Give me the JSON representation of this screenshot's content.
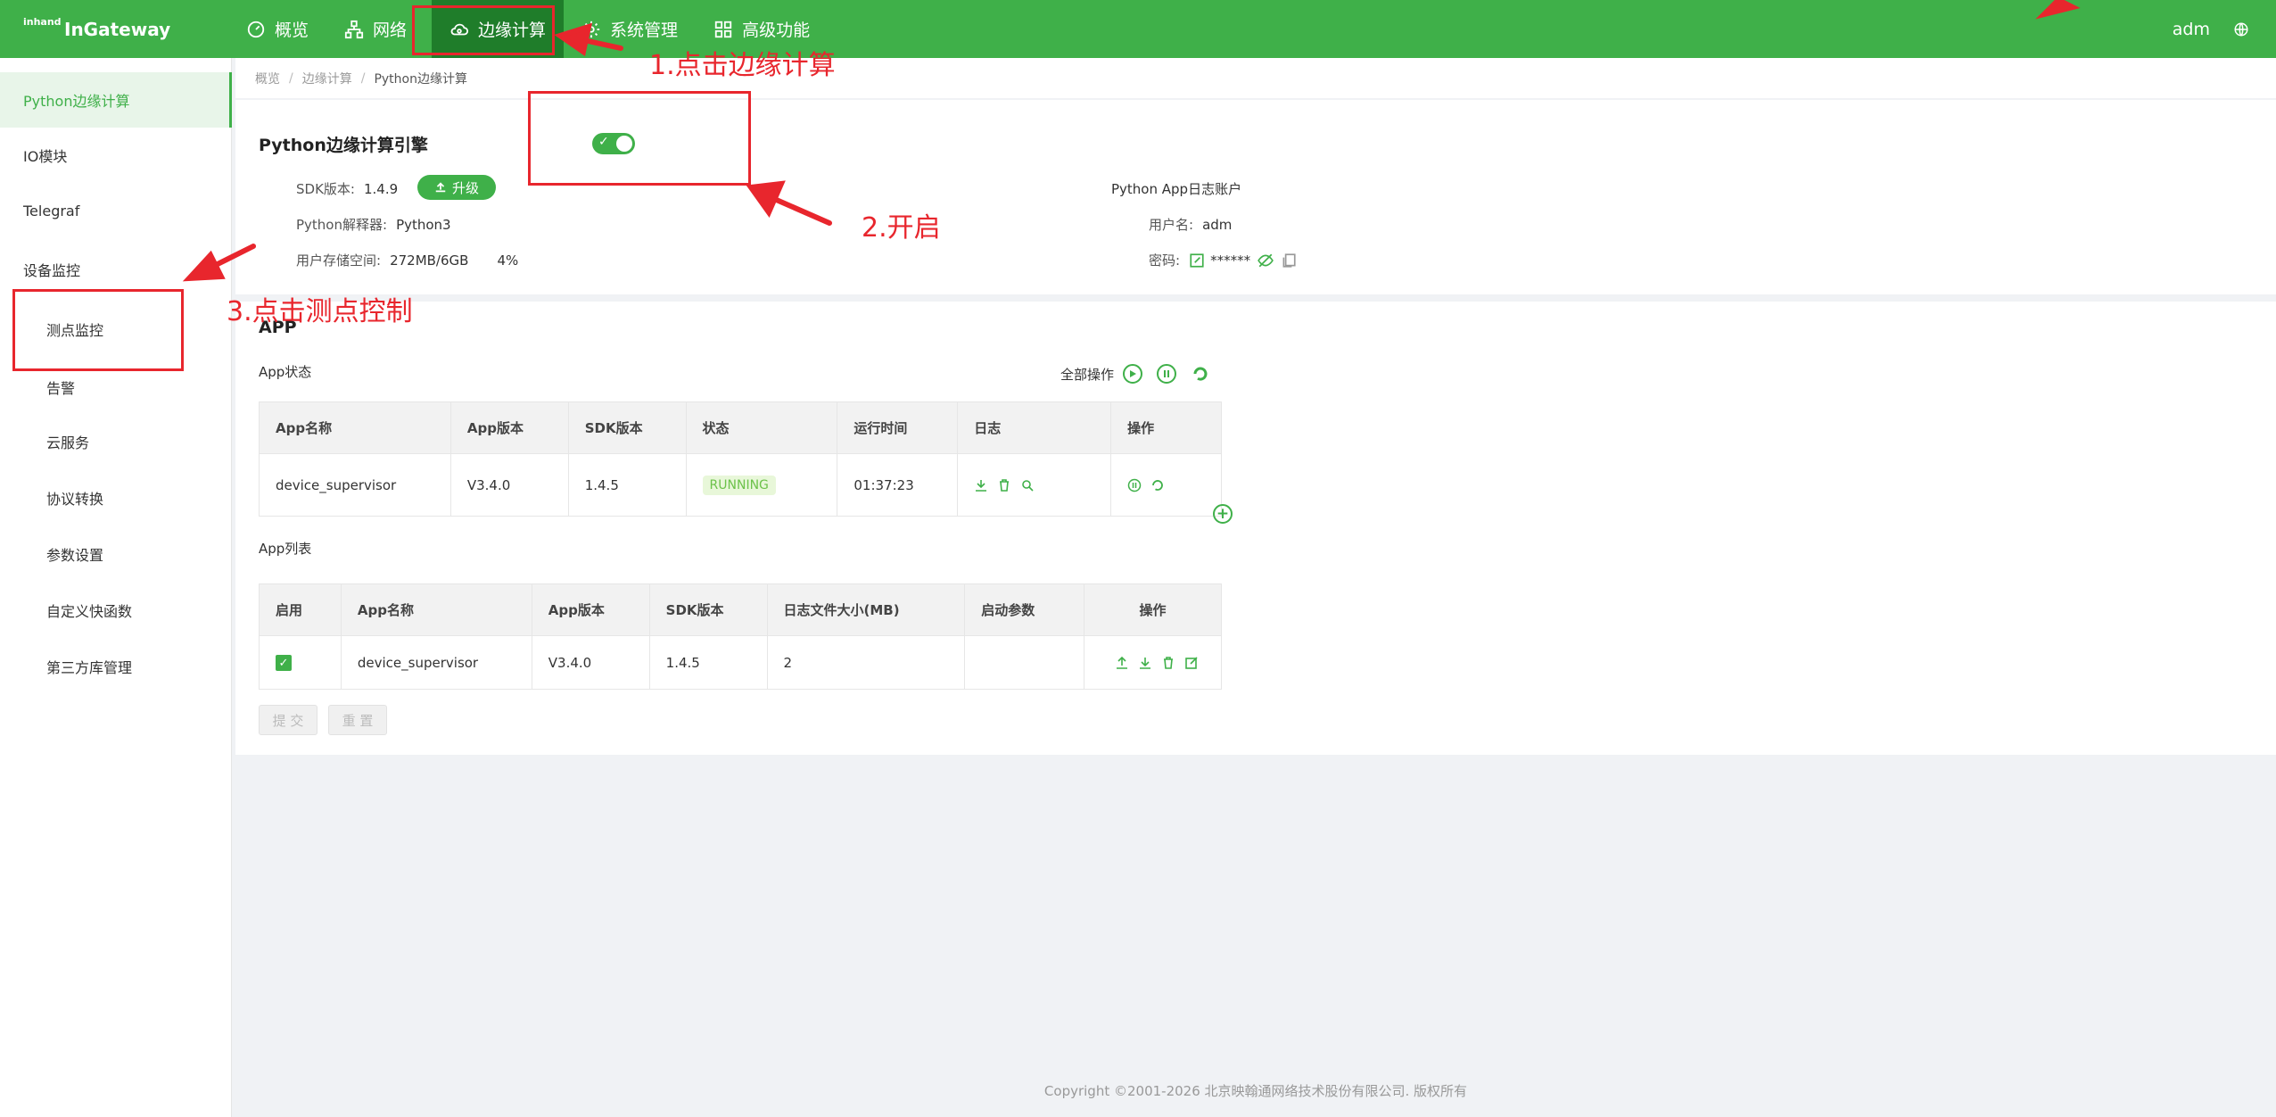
{
  "header": {
    "logo": "InGateway",
    "logo_mark_top": "inhand",
    "nav": [
      {
        "label": "概览",
        "icon": "dashboard-icon"
      },
      {
        "label": "网络",
        "icon": "network-icon"
      },
      {
        "label": "边缘计算",
        "icon": "cloud-compute-icon"
      },
      {
        "label": "系统管理",
        "icon": "gear-icon"
      },
      {
        "label": "高级功能",
        "icon": "grid-icon"
      }
    ],
    "user": "adm",
    "language_icon": "globe-icon"
  },
  "sidebar": {
    "items": [
      {
        "label": "Python边缘计算"
      },
      {
        "label": "IO模块"
      },
      {
        "label": "Telegraf"
      },
      {
        "label": "设备监控"
      },
      {
        "label": "测点监控"
      },
      {
        "label": "告警"
      },
      {
        "label": "云服务"
      },
      {
        "label": "协议转换"
      },
      {
        "label": "参数设置"
      },
      {
        "label": "自定义快函数"
      },
      {
        "label": "第三方库管理"
      }
    ]
  },
  "breadcrumb": [
    "概览",
    "边缘计算",
    "Python边缘计算"
  ],
  "engine": {
    "title": "Python边缘计算引擎",
    "enabled": true,
    "sdk_label": "SDK版本:",
    "sdk_value": "1.4.9",
    "upgrade_label": "升级",
    "interpreter_label": "Python解释器:",
    "interpreter_value": "Python3",
    "storage_label": "用户存储空间:",
    "storage_value": "272MB/6GB",
    "storage_percent": "4%",
    "account_title": "Python App日志账户",
    "username_label": "用户名:",
    "username_value": "adm",
    "password_label": "密码:",
    "password_value": "******"
  },
  "app": {
    "title": "APP",
    "status_title": "App状态",
    "all_ops_label": "全部操作",
    "status_headers": [
      "App名称",
      "App版本",
      "SDK版本",
      "状态",
      "运行时间",
      "日志",
      "操作"
    ],
    "status_rows": [
      {
        "name": "device_supervisor",
        "version": "V3.4.0",
        "sdk": "1.4.5",
        "status": "RUNNING",
        "uptime": "01:37:23"
      }
    ],
    "list_title": "App列表",
    "list_headers": [
      "启用",
      "App名称",
      "App版本",
      "SDK版本",
      "日志文件大小(MB)",
      "启动参数",
      "操作"
    ],
    "list_rows": [
      {
        "enabled": true,
        "name": "device_supervisor",
        "version": "V3.4.0",
        "sdk": "1.4.5",
        "log_size": "2",
        "params": ""
      }
    ],
    "submit_label": "提 交",
    "reset_label": "重 置"
  },
  "footer": "Copyright ©2001-2026 北京映翰通网络技术股份有限公司. 版权所有",
  "annotations": {
    "step1": "1.点击边缘计算",
    "step2": "2.开启",
    "step3": "3.点击测点控制",
    "color": "#e8262d"
  },
  "colors": {
    "brand": "#3fb049",
    "brand_dark": "#1f7d2a",
    "running_bg": "#e8f7d9",
    "running_text": "#6cc24a"
  }
}
